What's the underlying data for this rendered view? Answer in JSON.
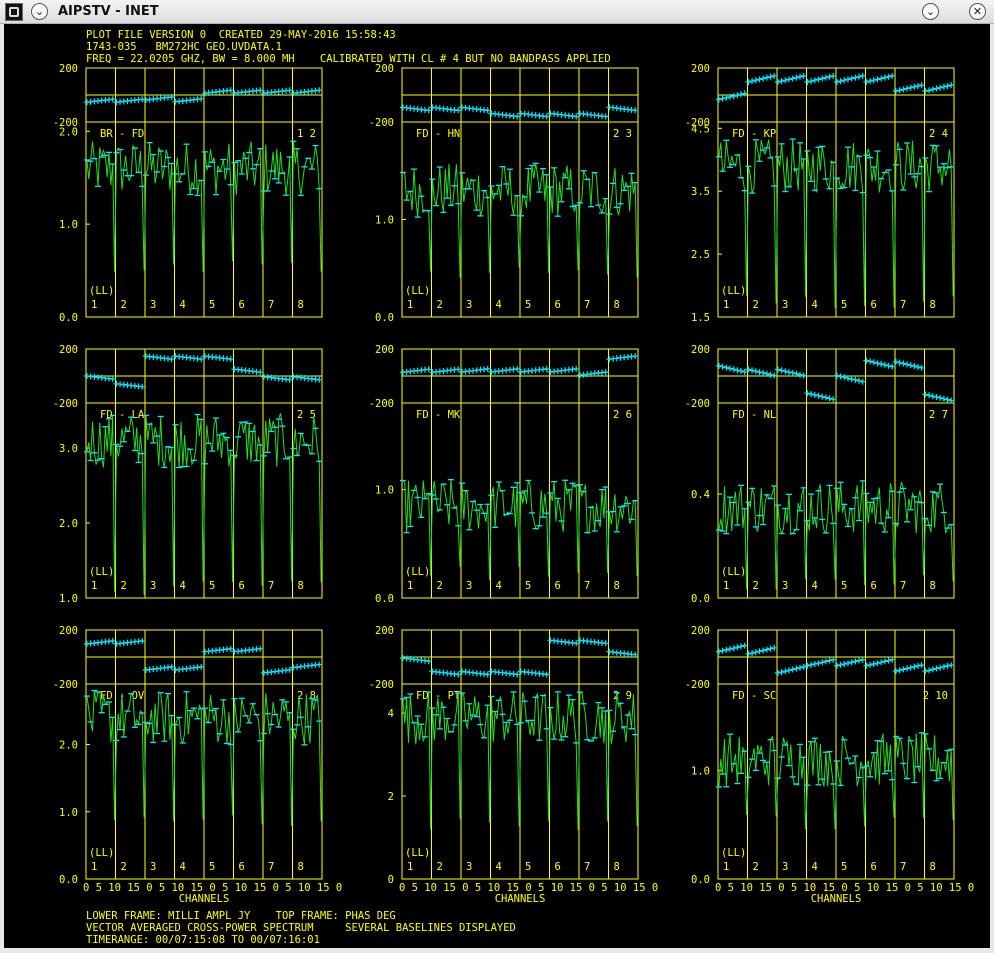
{
  "window": {
    "title": "AIPSTV - INET",
    "menu_icon": "chevron-down-icon",
    "close_icon": "close-icon"
  },
  "header": {
    "line1": "PLOT FILE VERSION 0  CREATED 29-MAY-2016 15:58:43",
    "line2": "1743-035   BM272HC GEO.UVDATA.1",
    "line3": "FREQ = 22.0205 GHZ, BW = 8.000 MH    CALIBRATED WITH CL # 4 BUT NO BANDPASS APPLIED"
  },
  "footer": {
    "line1": "LOWER FRAME: MILLI AMPL JY    TOP FRAME: PHAS DEG",
    "line2": "VECTOR AVERAGED CROSS-POWER SPECTRUM     SEVERAL BASELINES DISPLAYED",
    "line3": "TIMERANGE: 00/07:15:08 TO 00/07:16:01"
  },
  "colors": {
    "axes": "#ffff00",
    "points": "#00e5ff",
    "line": "#22dd22",
    "background": "#000000"
  },
  "chart_data": {
    "type": "line",
    "xlabel": "CHANNELS",
    "top_frame_ylim": [
      -200,
      200
    ],
    "top_frame_tick_labels": [
      "200",
      "-200"
    ],
    "polarization_label": "(LL)",
    "if_labels": [
      "1",
      "2",
      "3",
      "4",
      "5",
      "6",
      "7",
      "8"
    ],
    "x_tick_labels": [
      "0",
      "5",
      "10",
      "15",
      "0",
      "5",
      "10",
      "15",
      "0",
      "5",
      "10",
      "15",
      "0",
      "5",
      "10",
      "15",
      "0",
      "5",
      "10",
      "15",
      "0",
      "5",
      "10",
      "15",
      "0",
      "5",
      "10",
      "15",
      "0",
      "5",
      "10",
      "15"
    ],
    "panels": [
      {
        "baseline": "BR - FD",
        "antenna_numbers": "1 2",
        "ylim": [
          0,
          2.1
        ],
        "yticks": [
          "2.0",
          "1.0",
          "0.0"
        ],
        "mean": 1.6,
        "dip": 0.5
      },
      {
        "baseline": "FD - HN",
        "antenna_numbers": "2 3",
        "ylim": [
          0,
          2.0
        ],
        "yticks": [
          "1.0",
          "0.0"
        ],
        "mean": 1.3,
        "dip": 0.4
      },
      {
        "baseline": "FD - KP",
        "antenna_numbers": "2 4",
        "ylim": [
          1.5,
          4.6
        ],
        "yticks": [
          "4.5",
          "3.5",
          "2.5",
          "1.5"
        ],
        "mean": 3.9,
        "dip": 1.7
      },
      {
        "baseline": "FD - LA",
        "antenna_numbers": "2 5",
        "ylim": [
          1.0,
          3.6
        ],
        "yticks": [
          "3.0",
          "2.0",
          "1.0"
        ],
        "mean": 3.1,
        "dip": 1.1
      },
      {
        "baseline": "FD - MK",
        "antenna_numbers": "2 6",
        "ylim": [
          0,
          1.8
        ],
        "yticks": [
          "1.0",
          "0.0"
        ],
        "mean": 0.85,
        "dip": 0.2
      },
      {
        "baseline": "FD - NL",
        "antenna_numbers": "2 7",
        "ylim": [
          0,
          0.75
        ],
        "yticks": [
          "0.4",
          "0.0"
        ],
        "mean": 0.35,
        "dip": 0.05
      },
      {
        "baseline": "FD - OV",
        "antenna_numbers": "2 8",
        "ylim": [
          0,
          2.9
        ],
        "yticks": [
          "2.0",
          "1.0",
          "0.0"
        ],
        "mean": 2.4,
        "dip": 0.8
      },
      {
        "baseline": "FD - PT",
        "antenna_numbers": "2 9",
        "ylim": [
          0,
          4.7
        ],
        "yticks": [
          "4",
          "2",
          "0"
        ],
        "mean": 3.9,
        "dip": 1.2
      },
      {
        "baseline": "FD - SC",
        "antenna_numbers": "2 10",
        "ylim": [
          0,
          1.8
        ],
        "yticks": [
          "1.0",
          "0.0"
        ],
        "mean": 1.1,
        "dip": 0.5
      }
    ]
  }
}
